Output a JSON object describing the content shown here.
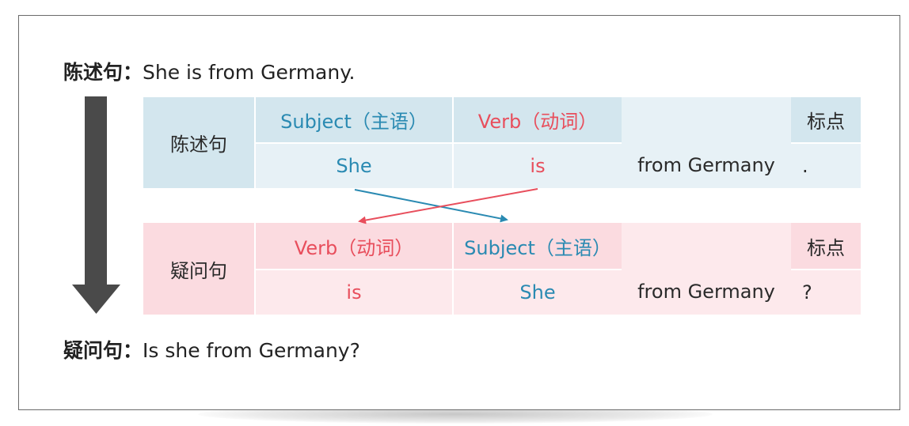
{
  "statement_line": {
    "label": "陈述句：",
    "text": "She is from Germany."
  },
  "question_line": {
    "label": "疑问句：",
    "text": "Is she from Germany?"
  },
  "statement_table": {
    "row_label": "陈述句",
    "headers": [
      "Subject（主语）",
      "Verb（动词）",
      "标点"
    ],
    "values": [
      "She",
      "is",
      "from Germany",
      "."
    ]
  },
  "question_table": {
    "row_label": "疑问句",
    "headers": [
      "Verb（动词）",
      "Subject（主语）",
      "标点"
    ],
    "values": [
      "is",
      "She",
      "from Germany",
      "?"
    ]
  },
  "colors": {
    "subject_blue": "#2a8ab2",
    "verb_red": "#e84e5c",
    "statement_bg": "#d3e6ee",
    "question_bg": "#fbdbe0",
    "arrow_gray": "#4a4a4a"
  }
}
